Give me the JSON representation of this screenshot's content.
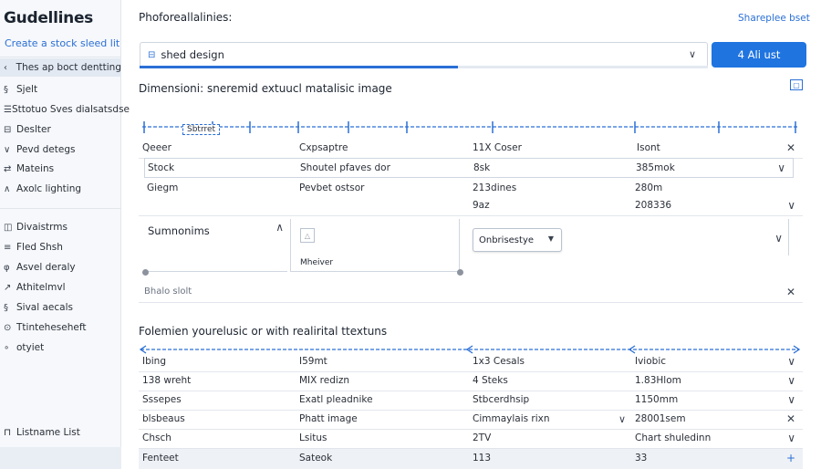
{
  "sidebar": {
    "title": "Gudellines",
    "link": "Create a stock sleed lit",
    "items": [
      {
        "icon": "‹",
        "label": "Thes ap boct dentting",
        "active": true
      },
      {
        "icon": "§",
        "label": "Sjelt"
      },
      {
        "icon": "☰",
        "label": "Sttotuo Sves dialsatsdse"
      },
      {
        "icon": "⊟",
        "label": "Deslter"
      },
      {
        "icon": "∨",
        "label": "Pevd detegs"
      },
      {
        "icon": "⇄",
        "label": "Mateins"
      },
      {
        "icon": "∧",
        "label": "Axolc lighting"
      },
      {
        "icon": "◫",
        "label": "Divaistrms"
      },
      {
        "icon": "≡",
        "label": "Fled Shsh"
      },
      {
        "icon": "φ",
        "label": "Asvel deraly"
      },
      {
        "icon": "↗",
        "label": "Athitelmvl"
      },
      {
        "icon": "§",
        "label": "Sival aecals"
      },
      {
        "icon": "⊙",
        "label": "Ttinteheseheft"
      },
      {
        "icon": "∘",
        "label": "otyiet"
      }
    ],
    "bottom": {
      "icon": "⊓",
      "label": "Listname List"
    }
  },
  "header": {
    "title": "Phoforeallalinies:",
    "link": "Shareplee bset"
  },
  "select": {
    "icon": "⊟",
    "value": "shed design",
    "progress": 0.56
  },
  "primary_button": "4 Ali ust",
  "section1": {
    "title": "Dimensioni: sneremid extuucl matalisic image",
    "tab_label": "Sbtrret",
    "header_row": [
      "Qeeer",
      "Cxpsaptre",
      "11X Coser",
      "Isont"
    ],
    "rows": [
      [
        "Stock",
        "Shoutel pfaves dor",
        "8sk",
        "385mok"
      ],
      [
        "Giegm",
        "Pevbet ostsor",
        "213dines",
        "280m"
      ],
      [
        "",
        "",
        "9az",
        "208336"
      ]
    ],
    "panel_left_title": "Sumnonims",
    "panel_mid_label": "Mheiver",
    "dropdown_value": "Onbrisestye",
    "footer_label": "Bhalo slolt"
  },
  "section2": {
    "title": "Folemien yourelusic or with realirital ttextuns",
    "header_row": [
      "Ibing",
      "I59mt",
      "1x3 Cesals",
      "Iviobic"
    ],
    "rows": [
      [
        "138 wreht",
        "MIX redizn",
        "4 Steks",
        "1.83Hlom"
      ],
      [
        "Sssepes",
        "Exatl pleadnike",
        "Stbcerdhsip",
        "1150mm"
      ],
      [
        "blsbeaus",
        "Phatt image",
        "Cimmaylais rixn",
        "28001sem"
      ],
      [
        "Chsch",
        "Lsitus",
        "2TV",
        "Chart shuledinn"
      ],
      [
        "Fenteet",
        "Sateok",
        "113",
        "33"
      ]
    ]
  },
  "colors": {
    "accent": "#1f74e0",
    "link": "#2a6fd6",
    "sidebar_bg": "#f6f8fb"
  }
}
